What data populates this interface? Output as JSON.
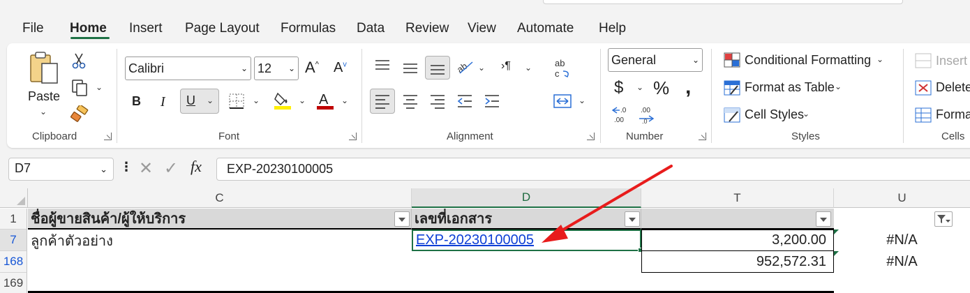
{
  "menu": {
    "tabs": [
      "File",
      "Home",
      "Insert",
      "Page Layout",
      "Formulas",
      "Data",
      "Review",
      "View",
      "Automate",
      "Help"
    ],
    "active": "Home"
  },
  "ribbon": {
    "clipboard": {
      "paste_label": "Paste",
      "group_label": "Clipboard"
    },
    "font": {
      "font_name": "Calibri",
      "font_size": "12",
      "bold": "B",
      "italic": "I",
      "underline": "U",
      "group_label": "Font"
    },
    "alignment": {
      "group_label": "Alignment"
    },
    "number": {
      "format": "General",
      "group_label": "Number"
    },
    "styles": {
      "conditional_formatting": "Conditional Formatting",
      "format_as_table": "Format as Table",
      "cell_styles": "Cell Styles",
      "group_label": "Styles"
    },
    "cells": {
      "insert": "Insert",
      "delete": "Delete",
      "format": "Format",
      "group_label": "Cells"
    }
  },
  "formula_bar": {
    "name_box": "D7",
    "fx": "fx",
    "content": "EXP-20230100005"
  },
  "grid": {
    "columns": [
      "C",
      "D",
      "T",
      "U"
    ],
    "selected_column": "D",
    "row_numbers": [
      "1",
      "7",
      "168",
      "169"
    ],
    "header_row": {
      "C": "ชื่อผู้ขายสินค้า/ผู้ให้บริการ",
      "D": "เลขที่เอกสาร",
      "T": ""
    },
    "row7": {
      "C": "ลูกค้าตัวอย่าง",
      "D": "EXP-20230100005",
      "T": "3,200.00",
      "U": "#N/A"
    },
    "row168": {
      "T": "952,572.31",
      "U": "#N/A"
    }
  },
  "colors": {
    "accent": "#1e7145",
    "arrow": "#e81c1c",
    "link": "#0d3fd6"
  }
}
